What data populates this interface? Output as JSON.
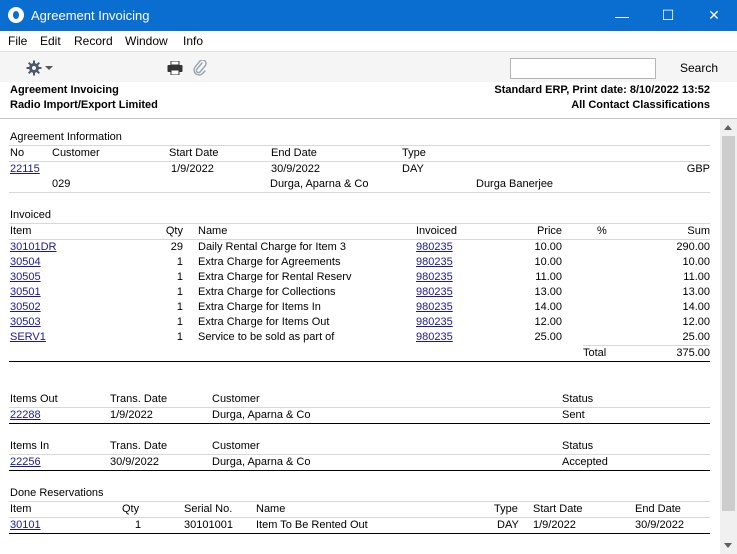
{
  "window": {
    "title": "Agreement Invoicing",
    "minimize": "—",
    "maximize": "☐",
    "close": "✕"
  },
  "menu": [
    "File",
    "Edit",
    "Record",
    "Window",
    "Info"
  ],
  "toolbar": {
    "search_label": "Search",
    "search_value": ""
  },
  "header": {
    "left_line1": "Agreement Invoicing",
    "left_line2": "Radio Import/Export Limited",
    "right_line1": "Standard ERP, Print date: 8/10/2022 13:52",
    "right_line2": "All Contact Classifications"
  },
  "agreement": {
    "section": "Agreement Information",
    "headers": {
      "no": "No",
      "customer": "Customer",
      "start": "Start Date",
      "end": "End Date",
      "type": "Type"
    },
    "no": "22115",
    "start": "1/9/2022",
    "end": "30/9/2022",
    "type": "DAY",
    "currency": "GBP",
    "customer_code": "029",
    "customer_name": "Durga, Aparna & Co",
    "contact": "Durga Banerjee"
  },
  "invoiced": {
    "section": "Invoiced",
    "headers": {
      "item": "Item",
      "qty": "Qty",
      "name": "Name",
      "invoiced": "Invoiced",
      "price": "Price",
      "pct": "%",
      "sum": "Sum"
    },
    "rows": [
      {
        "item": "30101DR",
        "qty": "29",
        "name": "Daily Rental Charge for Item 3",
        "invoiced": "980235",
        "price": "10.00",
        "sum": "290.00"
      },
      {
        "item": "30504",
        "qty": "1",
        "name": "Extra Charge for Agreements",
        "invoiced": "980235",
        "price": "10.00",
        "sum": "10.00"
      },
      {
        "item": "30505",
        "qty": "1",
        "name": "Extra Charge for Rental Reserv",
        "invoiced": "980235",
        "price": "11.00",
        "sum": "11.00"
      },
      {
        "item": "30501",
        "qty": "1",
        "name": "Extra Charge for Collections",
        "invoiced": "980235",
        "price": "13.00",
        "sum": "13.00"
      },
      {
        "item": "30502",
        "qty": "1",
        "name": "Extra Charge for Items In",
        "invoiced": "980235",
        "price": "14.00",
        "sum": "14.00"
      },
      {
        "item": "30503",
        "qty": "1",
        "name": "Extra Charge for Items Out",
        "invoiced": "980235",
        "price": "12.00",
        "sum": "12.00"
      },
      {
        "item": "SERV1",
        "qty": "1",
        "name": "Service to be sold as part of",
        "invoiced": "980235",
        "price": "25.00",
        "sum": "25.00"
      }
    ],
    "total_label": "Total",
    "total_value": "375.00"
  },
  "items_out": {
    "headers": {
      "no": "Items Out",
      "date": "Trans. Date",
      "customer": "Customer",
      "status": "Status"
    },
    "no": "22288",
    "date": "1/9/2022",
    "customer": "Durga, Aparna & Co",
    "status": "Sent"
  },
  "items_in": {
    "headers": {
      "no": "Items In",
      "date": "Trans. Date",
      "customer": "Customer",
      "status": "Status"
    },
    "no": "22256",
    "date": "30/9/2022",
    "customer": "Durga, Aparna & Co",
    "status": "Accepted"
  },
  "reservations": {
    "section": "Done Reservations",
    "headers": {
      "item": "Item",
      "qty": "Qty",
      "serial": "Serial No.",
      "name": "Name",
      "type": "Type",
      "start": "Start Date",
      "end": "End Date"
    },
    "item": "30101",
    "qty": "1",
    "serial": "30101001",
    "name": "Item To Be Rented Out",
    "type": "DAY",
    "start": "1/9/2022",
    "end": "30/9/2022"
  }
}
